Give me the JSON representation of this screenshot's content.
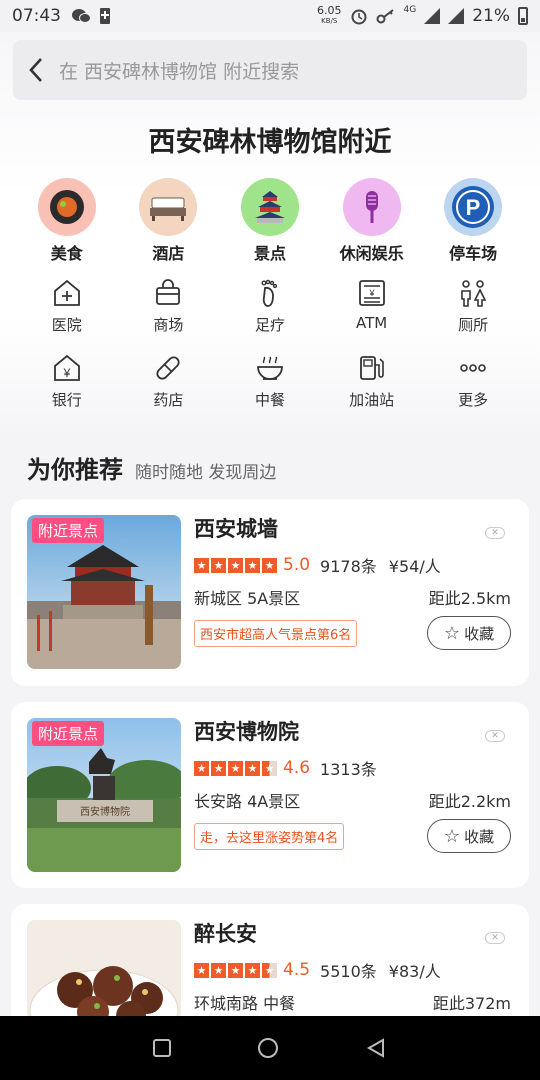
{
  "status_bar": {
    "time": "07:43",
    "speed_value": "6.05",
    "speed_unit": "KB/S",
    "network": "4G",
    "battery": "21%"
  },
  "search": {
    "placeholder": "在 西安碑林博物馆 附近搜索"
  },
  "page_title": "西安碑林博物馆附近",
  "main_categories": [
    {
      "label": "美食",
      "icon": "food-icon",
      "color": "#f9c0b6"
    },
    {
      "label": "酒店",
      "icon": "hotel-icon",
      "color": "#f3d5c0"
    },
    {
      "label": "景点",
      "icon": "scenic-icon",
      "color": "#9fe38a"
    },
    {
      "label": "休闲娱乐",
      "icon": "entertainment-icon",
      "color": "#efb8f0"
    },
    {
      "label": "停车场",
      "icon": "parking-icon",
      "color": "#1f5fb8"
    }
  ],
  "sub_categories_row1": [
    {
      "label": "医院",
      "icon": "hospital-icon"
    },
    {
      "label": "商场",
      "icon": "mall-icon"
    },
    {
      "label": "足疗",
      "icon": "foot-massage-icon"
    },
    {
      "label": "ATM",
      "icon": "atm-icon"
    },
    {
      "label": "厕所",
      "icon": "toilet-icon"
    }
  ],
  "sub_categories_row2": [
    {
      "label": "银行",
      "icon": "bank-icon"
    },
    {
      "label": "药店",
      "icon": "pharmacy-icon"
    },
    {
      "label": "中餐",
      "icon": "chinese-food-icon"
    },
    {
      "label": "加油站",
      "icon": "gas-station-icon"
    },
    {
      "label": "更多",
      "icon": "more-icon"
    }
  ],
  "recommend": {
    "title": "为你推荐",
    "subtitle": "随时随地 发现周边"
  },
  "cards": [
    {
      "tag": "附近景点",
      "name": "西安城墙",
      "rating": 5,
      "score": "5.0",
      "reviews": "9178条",
      "price": "¥54/人",
      "area": "新城区  5A景区",
      "distance": "距此2.5km",
      "rank": "西安市超高人气景点第6名",
      "collect": "收藏"
    },
    {
      "tag": "附近景点",
      "name": "西安博物院",
      "rating": 4.6,
      "score": "4.6",
      "reviews": "1313条",
      "price": "",
      "area": "长安路  4A景区",
      "distance": "距此2.2km",
      "rank": "走，去这里涨姿势第4名",
      "collect": "收藏"
    },
    {
      "tag": "",
      "name": "醉长安",
      "rating": 4.5,
      "score": "4.5",
      "reviews": "5510条",
      "price": "¥83/人",
      "area": "环城南路  中餐",
      "distance": "距此372m",
      "rank": "",
      "collect": ""
    }
  ]
}
